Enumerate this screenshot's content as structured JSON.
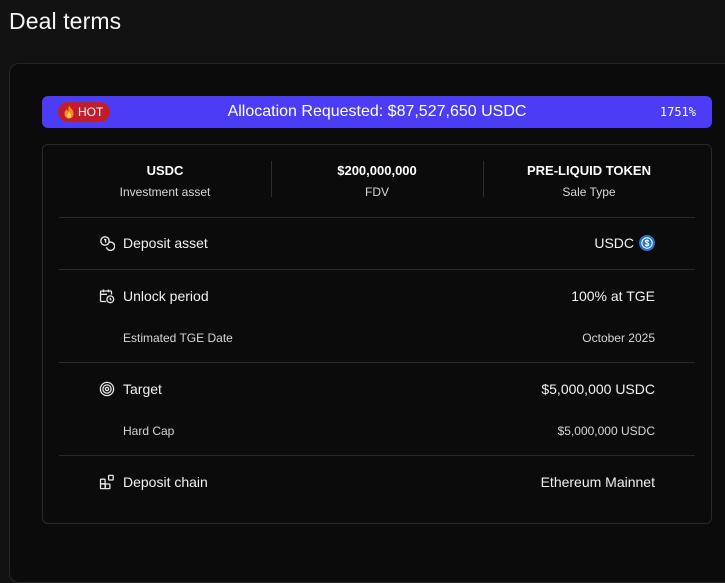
{
  "page": {
    "title": "Deal terms"
  },
  "allocation": {
    "badge": "HOT",
    "text": "Allocation Requested: $87,527,650 USDC",
    "percent": "1751%"
  },
  "summary": [
    {
      "value": "USDC",
      "label": "Investment asset"
    },
    {
      "value": "$200,000,000",
      "label": "FDV"
    },
    {
      "value": "PRE-LIQUID TOKEN",
      "label": "Sale Type"
    }
  ],
  "terms": {
    "deposit_asset": {
      "label": "Deposit asset",
      "value": "USDC",
      "icon": "coins-icon"
    },
    "unlock_period": {
      "label": "Unlock period",
      "value": "100% at TGE",
      "icon": "calendar-clock-icon",
      "sub_label": "Estimated TGE Date",
      "sub_value": "October 2025"
    },
    "target": {
      "label": "Target",
      "value": "$5,000,000 USDC",
      "icon": "target-icon",
      "sub_label": "Hard Cap",
      "sub_value": "$5,000,000 USDC"
    },
    "deposit_chain": {
      "label": "Deposit chain",
      "value": "Ethereum Mainnet",
      "icon": "blocks-icon"
    }
  },
  "colors": {
    "background": "#121212",
    "panel": "#0b0b0b",
    "allocation_bar": "#4a3df5",
    "hot_badge": "#c01e2c",
    "usdc_blue": "#2775ca"
  }
}
